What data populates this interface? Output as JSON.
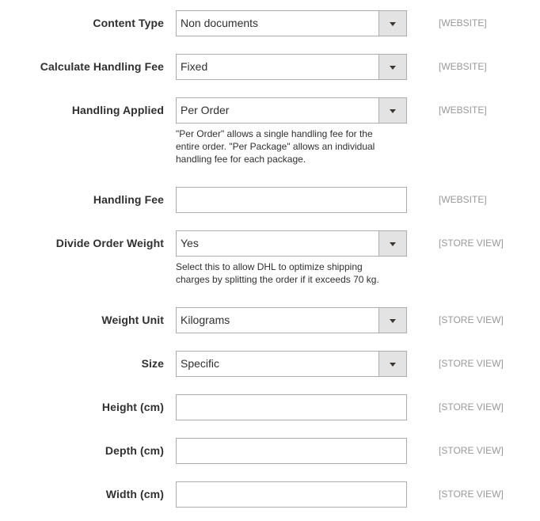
{
  "fields": [
    {
      "label": "Content Type",
      "type": "select",
      "value": "Non documents",
      "scope": "[WEBSITE]"
    },
    {
      "label": "Calculate Handling Fee",
      "type": "select",
      "value": "Fixed",
      "scope": "[WEBSITE]"
    },
    {
      "label": "Handling Applied",
      "type": "select",
      "value": "Per Order",
      "scope": "[WEBSITE]",
      "note": "\"Per Order\" allows a single handling fee for the entire order. \"Per Package\" allows an individual handling fee for each package."
    },
    {
      "label": "Handling Fee",
      "type": "text",
      "value": "",
      "scope": "[WEBSITE]"
    },
    {
      "label": "Divide Order Weight",
      "type": "select",
      "value": "Yes",
      "scope": "[STORE VIEW]",
      "note": "Select this to allow DHL to optimize shipping charges by splitting the order if it exceeds 70 kg."
    },
    {
      "label": "Weight Unit",
      "type": "select",
      "value": "Kilograms",
      "scope": "[STORE VIEW]"
    },
    {
      "label": "Size",
      "type": "select",
      "value": "Specific",
      "scope": "[STORE VIEW]"
    },
    {
      "label": "Height (cm)",
      "type": "text",
      "value": "",
      "scope": "[STORE VIEW]"
    },
    {
      "label": "Depth (cm)",
      "type": "text",
      "value": "",
      "scope": "[STORE VIEW]"
    },
    {
      "label": "Width (cm)",
      "type": "text",
      "value": "",
      "scope": "[STORE VIEW]"
    }
  ],
  "icons": {
    "select_arrow": "chevron-down-icon"
  }
}
